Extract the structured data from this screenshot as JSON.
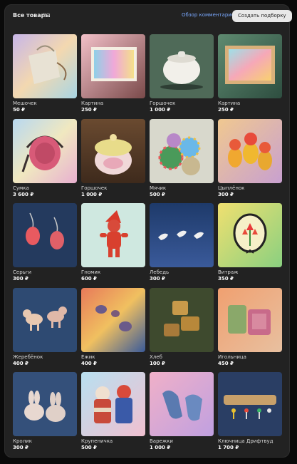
{
  "header": {
    "title": "Все товары",
    "count": "20",
    "review_link": "Обзор комментариев",
    "create_button": "Создать подборку"
  },
  "products": [
    {
      "name": "Мешочек",
      "price": "50 ₽",
      "icon": "pouch"
    },
    {
      "name": "Картина",
      "price": "250 ₽",
      "icon": "painting"
    },
    {
      "name": "Горшочек",
      "price": "1 000 ₽",
      "icon": "pot-white"
    },
    {
      "name": "Картина",
      "price": "250 ₽",
      "icon": "painting-framed"
    },
    {
      "name": "Сумка",
      "price": "3 600 ₽",
      "icon": "bag"
    },
    {
      "name": "Горшочек",
      "price": "1 000 ₽",
      "icon": "pot-lidded"
    },
    {
      "name": "Мячик",
      "price": "500 ₽",
      "icon": "balls"
    },
    {
      "name": "Цыплёнок",
      "price": "300 ₽",
      "icon": "chicks"
    },
    {
      "name": "Серьги",
      "price": "300 ₽",
      "icon": "earrings"
    },
    {
      "name": "Гномик",
      "price": "600 ₽",
      "icon": "gnome"
    },
    {
      "name": "Лебедь",
      "price": "300 ₽",
      "icon": "swans"
    },
    {
      "name": "Витраж",
      "price": "350 ₽",
      "icon": "stained-glass"
    },
    {
      "name": "Жеребёнок",
      "price": "400 ₽",
      "icon": "foals"
    },
    {
      "name": "Ёжик",
      "price": "400 ₽",
      "icon": "hedgehogs"
    },
    {
      "name": "Хлеб",
      "price": "100 ₽",
      "icon": "bread"
    },
    {
      "name": "Игольница",
      "price": "450 ₽",
      "icon": "pincushion"
    },
    {
      "name": "Кролик",
      "price": "300 ₽",
      "icon": "rabbits"
    },
    {
      "name": "Крупеничка",
      "price": "500 ₽",
      "icon": "dolls"
    },
    {
      "name": "Варежки",
      "price": "1 000 ₽",
      "icon": "mittens"
    },
    {
      "name": "Ключница Дрифтвуд",
      "price": "1 700 ₽",
      "icon": "key-holder"
    }
  ]
}
